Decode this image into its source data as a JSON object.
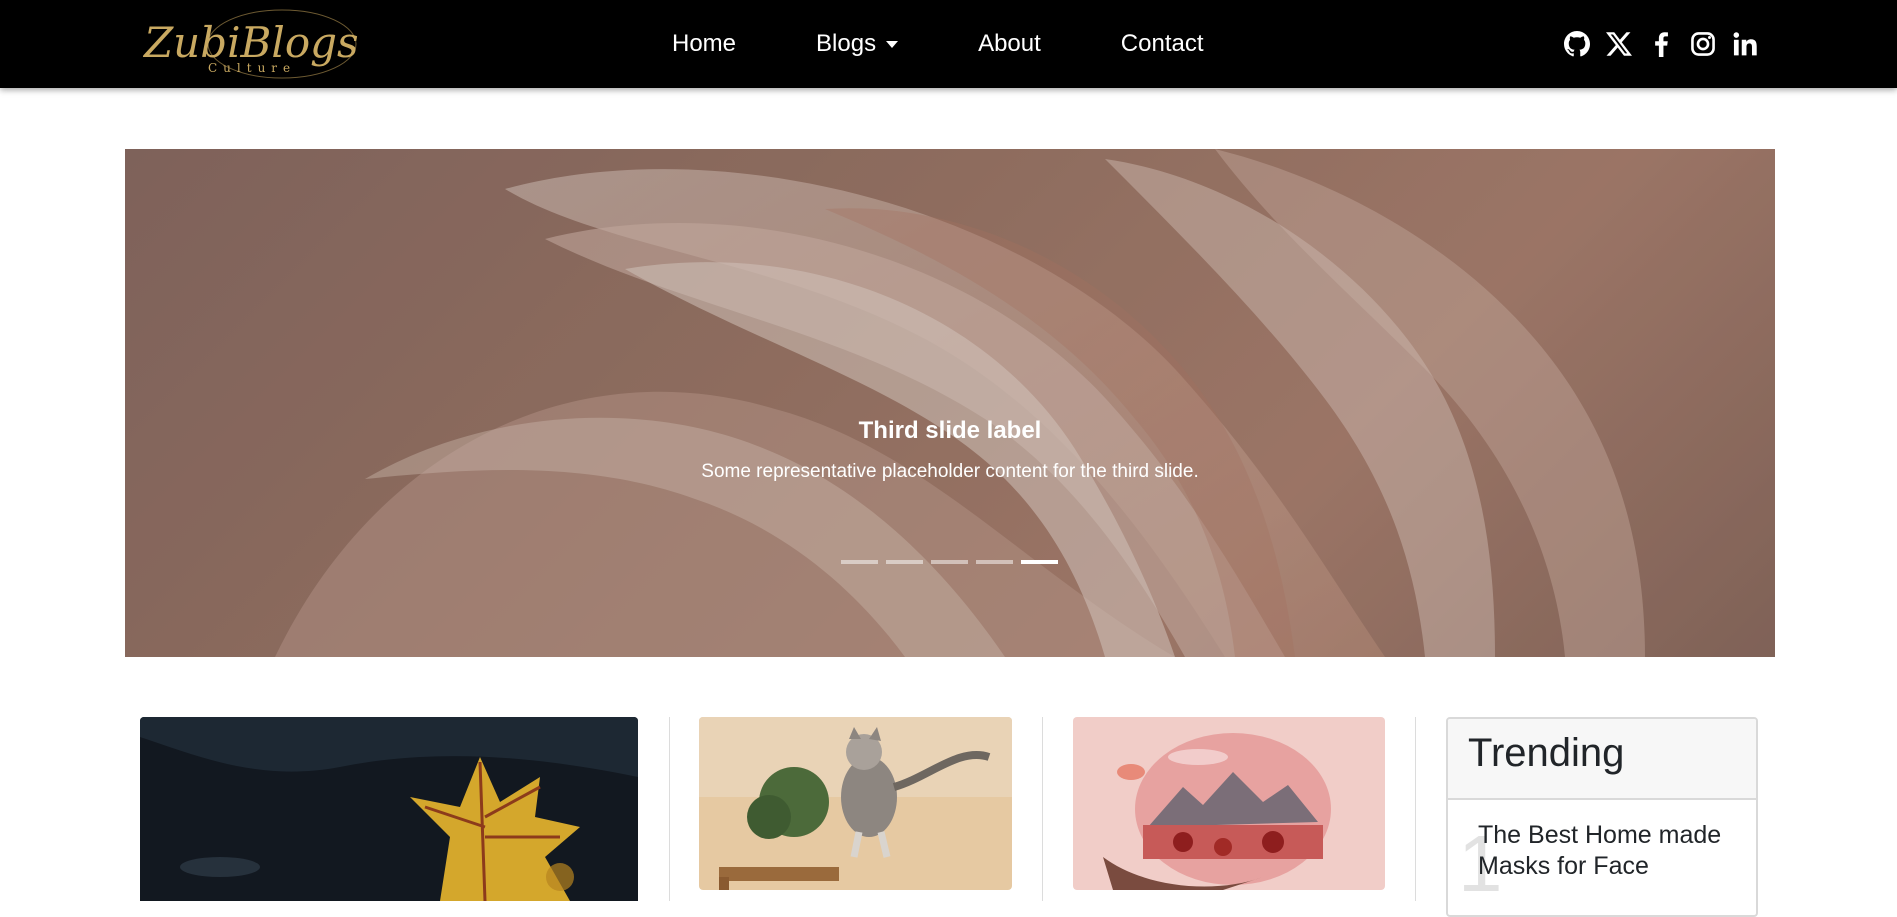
{
  "brand": {
    "logo_text": "ZubiBlogs",
    "logo_sub": "Culture"
  },
  "nav": {
    "home": "Home",
    "blogs": "Blogs",
    "about": "About",
    "contact": "Contact"
  },
  "socials": [
    "github-icon",
    "x-icon",
    "facebook-icon",
    "instagram-icon",
    "linkedin-icon"
  ],
  "carousel": {
    "title": "Third slide label",
    "text": "Some representative placeholder content for the third slide.",
    "slide_count": 5,
    "active_index": 4
  },
  "trending": {
    "title": "Trending",
    "items": [
      {
        "rank": "1",
        "title": "The Best Home made Masks for Face"
      }
    ]
  },
  "colors": {
    "navbar": "#000000",
    "logo_gold": "#c9a961",
    "accent_text": "#212529"
  }
}
